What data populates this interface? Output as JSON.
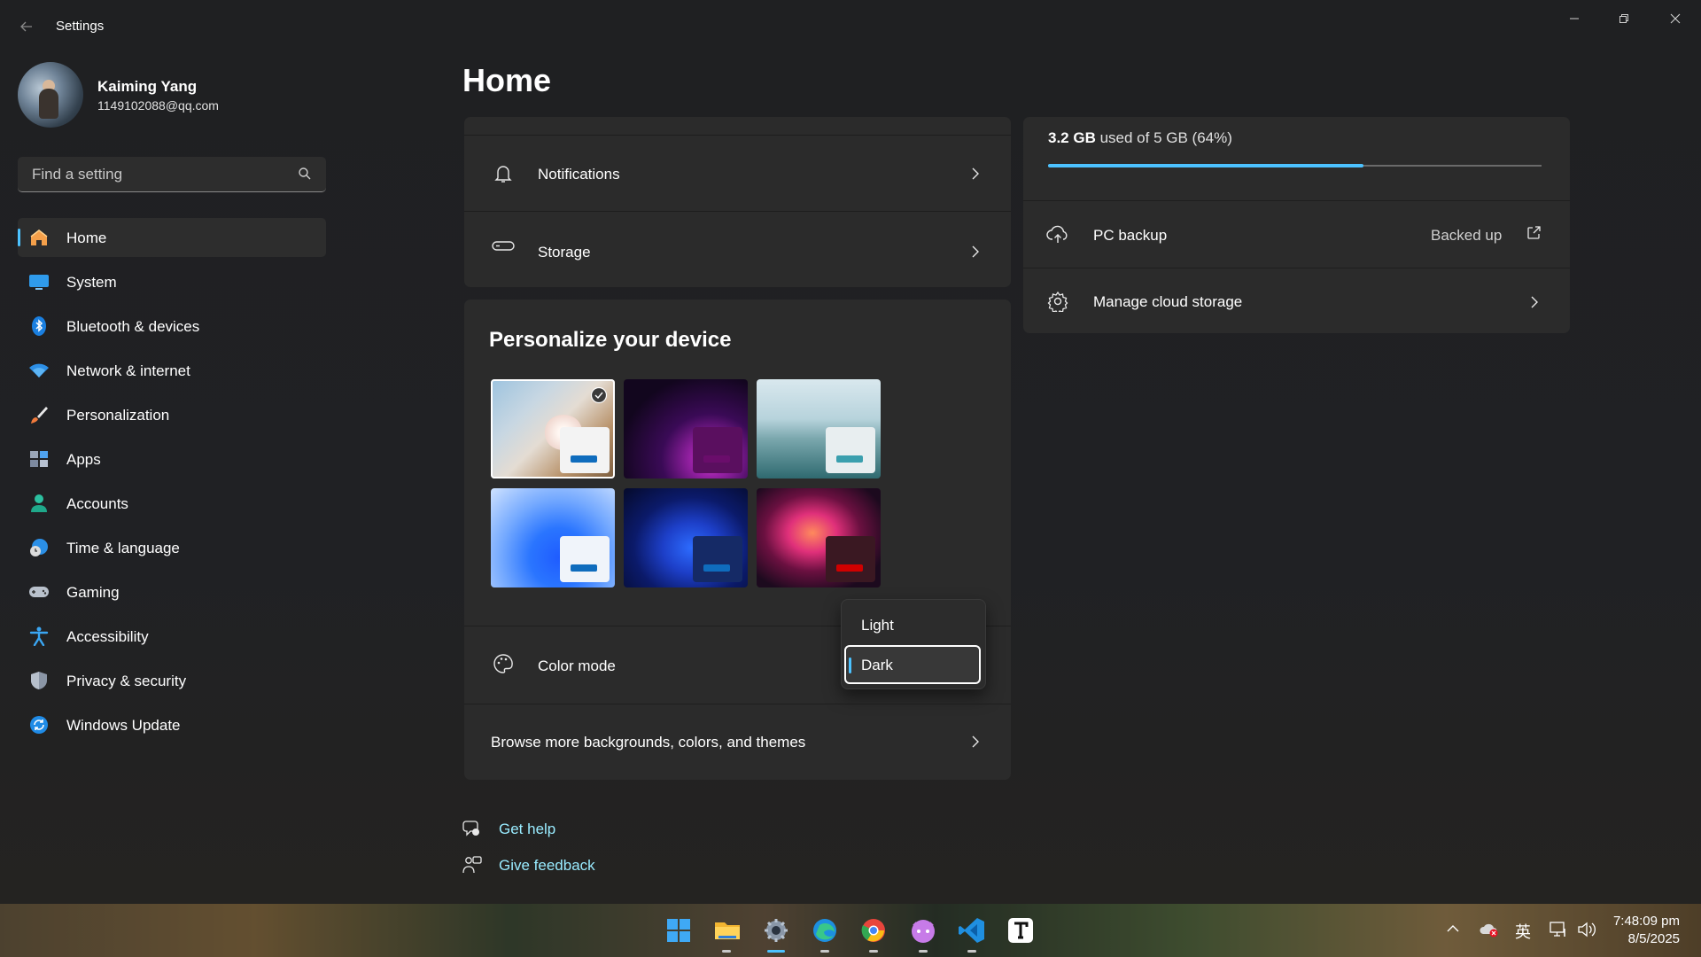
{
  "window": {
    "title": "Settings",
    "controls": [
      "minimize",
      "restore",
      "close"
    ]
  },
  "user": {
    "name": "Kaiming Yang",
    "email": "1149102088@qq.com"
  },
  "search": {
    "placeholder": "Find a setting"
  },
  "nav": {
    "items": [
      {
        "label": "Home",
        "icon": "home-icon",
        "active": true
      },
      {
        "label": "System",
        "icon": "monitor-icon"
      },
      {
        "label": "Bluetooth & devices",
        "icon": "bluetooth-icon"
      },
      {
        "label": "Network & internet",
        "icon": "wifi-icon"
      },
      {
        "label": "Personalization",
        "icon": "brush-icon"
      },
      {
        "label": "Apps",
        "icon": "apps-icon"
      },
      {
        "label": "Accounts",
        "icon": "person-icon"
      },
      {
        "label": "Time & language",
        "icon": "globe-clock-icon"
      },
      {
        "label": "Gaming",
        "icon": "controller-icon"
      },
      {
        "label": "Accessibility",
        "icon": "accessibility-icon"
      },
      {
        "label": "Privacy & security",
        "icon": "shield-icon"
      },
      {
        "label": "Windows Update",
        "icon": "update-icon"
      }
    ]
  },
  "main": {
    "title": "Home",
    "recommended": {
      "notifications": "Notifications",
      "storage": "Storage"
    },
    "personalize": {
      "title": "Personalize your device",
      "themes": [
        {
          "name": "flower-theme",
          "accent": "#0f6cbd",
          "selected": true
        },
        {
          "name": "purple-glow-theme",
          "accent": "#6a0d6b"
        },
        {
          "name": "lake-theme",
          "accent": "#3a9fae"
        },
        {
          "name": "bloom-light-theme",
          "accent": "#0f6cbd"
        },
        {
          "name": "bloom-dark-theme",
          "accent": "#0f6cbd"
        },
        {
          "name": "glow-flower-theme",
          "accent": "#d00000"
        }
      ],
      "color_mode_label": "Color mode",
      "color_mode_options": [
        "Light",
        "Dark"
      ],
      "color_mode_selected": "Dark",
      "browse_label": "Browse more backgrounds, colors, and themes"
    },
    "cloud": {
      "used_amount": "3.2 GB",
      "used_text": "used of 5 GB (64%)",
      "used_fraction": 0.64,
      "pc_backup_label": "PC backup",
      "pc_backup_status": "Backed up",
      "manage_label": "Manage cloud storage"
    },
    "links": {
      "get_help": "Get help",
      "give_feedback": "Give feedback"
    }
  },
  "taskbar": {
    "apps": [
      "windows-start-icon",
      "file-explorer-icon",
      "settings-icon",
      "edge-icon",
      "chrome-icon",
      "cat-app-icon",
      "vscode-icon",
      "typora-icon"
    ],
    "ime": "英",
    "time": "7:48:09 pm",
    "date": "8/5/2025"
  },
  "colors": {
    "accent": "#4cc2ff",
    "link": "#99ebff",
    "card": "#2b2b2b",
    "background": "#202020"
  }
}
